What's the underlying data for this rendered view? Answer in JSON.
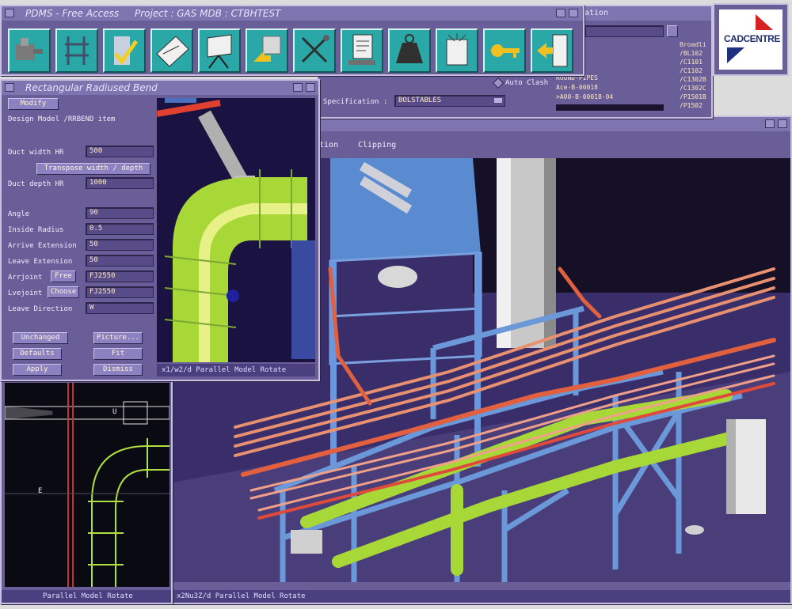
{
  "main_window": {
    "app_title": "PDMS - Free Access",
    "project_title": "Project : GAS  MDB : CTBHTEST"
  },
  "toolbar": {
    "tools": [
      {
        "icon": "equipment-icon"
      },
      {
        "icon": "structure-frame-icon"
      },
      {
        "icon": "check-door-icon"
      },
      {
        "icon": "drawing-icon"
      },
      {
        "icon": "easel-sheet-icon"
      },
      {
        "icon": "import-box-icon"
      },
      {
        "icon": "tools-wrench-icon"
      },
      {
        "icon": "document-spec-icon"
      },
      {
        "icon": "weight-icon"
      },
      {
        "icon": "book-icon"
      },
      {
        "icon": "key-icon"
      },
      {
        "icon": "exit-door-icon"
      }
    ]
  },
  "bg_window": {
    "title": "ation",
    "auto_clash": "Auto Clash",
    "specification_label": "Specification :",
    "specification_value": "BOLSTABLES",
    "list_items": [
      "ROUND-PIPES",
      "Ace-B-00018",
      ">A00-B-00018-04"
    ],
    "right_list": [
      "Broadli",
      "/BL102",
      "/C1101",
      "/C1102",
      "/C1302B",
      "/C1302C",
      "/P1501B",
      "/P1502"
    ]
  },
  "logo": {
    "text": "CADCENTRE"
  },
  "view_window": {
    "menu": [
      "ation",
      "Clipping"
    ]
  },
  "bend_form": {
    "title": "Rectangular Radiused Bend",
    "mode": "Modify",
    "design_model": "Design Model /RRBEND item",
    "duct_width_label": "Duct width  HR",
    "duct_width_value": "500",
    "transpose_label": "Transpose  width / depth",
    "duct_depth_label": "Duct depth  HR",
    "duct_depth_value": "1000",
    "angle_label": "Angle",
    "angle_value": "90",
    "inside_radius_label": "Inside Radius",
    "inside_radius_value": "0.5",
    "arrive_ext_label": "Arrive Extension",
    "arrive_ext_value": "50",
    "leave_ext_label": "Leave Extension",
    "leave_ext_value": "50",
    "arrjoint_label": "Arrjoint",
    "arrjoint_btn": "Free",
    "arrjoint_value": "FJ2550",
    "lvejoint_label": "Lvejoint",
    "lvejoint_btn": "Choose",
    "lvejoint_value": "FJ2550",
    "leave_dir_label": "Leave Direction",
    "leave_dir_value": "W",
    "unchanged": "Unchanged",
    "picture": "Picture...",
    "defaults": "Defaults",
    "fit": "Fit",
    "apply": "Apply",
    "dismiss": "Dismiss",
    "view_status": "x1/w2/d Parallel Model Rotate"
  },
  "left_view": {
    "status": "Parallel Model Rotate",
    "label_u": "U",
    "label_e": "E"
  },
  "main_view": {
    "status": "x2Nu3Z/d Parallel Model Rotate"
  }
}
